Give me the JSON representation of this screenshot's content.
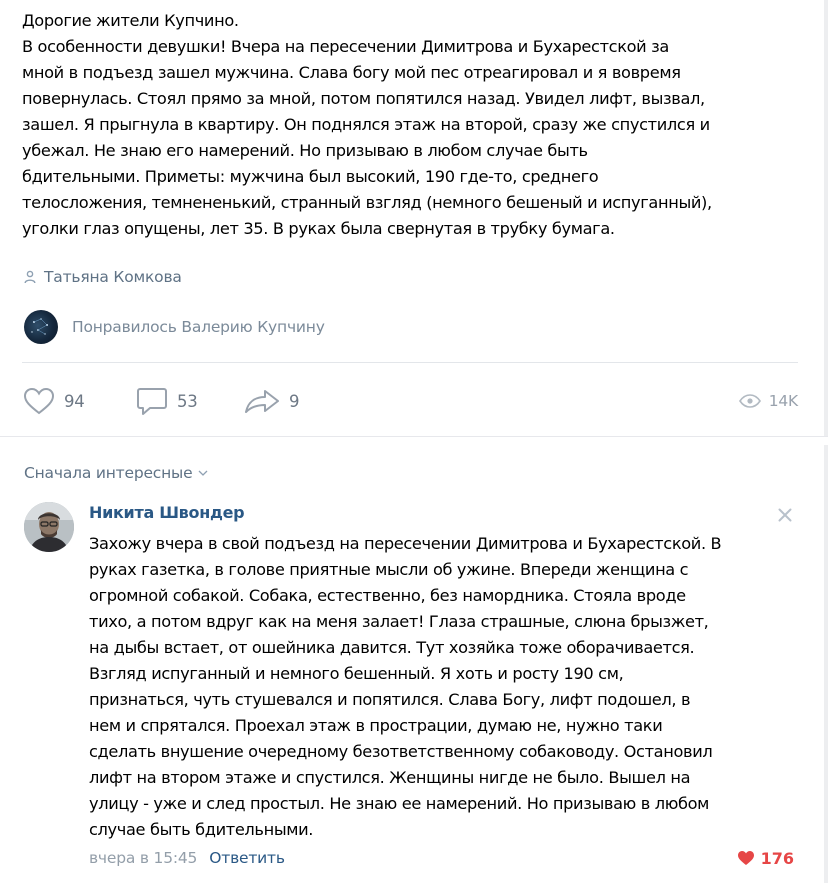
{
  "post": {
    "lines": [
      "Дорогие жители Купчино.",
      "В особенности девушки! Вчера на пересечении Димитрова и Бухарестской за",
      "мной в подъезд зашел мужчина. Слава богу мой пес отреагировал и я вовремя",
      "повернулась. Стоял прямо за мной, потом попятился назад. Увидел лифт, вызвал,",
      "зашел. Я прыгнула в квартиру. Он поднялся этаж на второй, сразу же спустился и",
      "убежал. Не знаю его намерений. Но призываю в любом случае быть",
      "бдительными. Приметы: мужчина был высокий, 190 где-то, среднего",
      "телосложения, темнененький, странный взгляд (немного бешеный и испуганный),",
      "уголки глаз опущены, лет 35. В руках была свернутая в трубку бумага."
    ],
    "author": "Татьяна Комкова",
    "liked_by": "Понравилось Валерию Купчину",
    "likes": "94",
    "comments": "53",
    "shares": "9",
    "views": "14K"
  },
  "sort_label": "Сначала интересные",
  "comment": {
    "name": "Никита Швондер",
    "lines": [
      "Захожу вчера в свой подъезд на пересечении Димитрова и Бухарестской. В",
      "руках газетка, в голове приятные мысли об ужине. Впереди женщина с",
      "огромной собакой. Собака, естественно, без намордника. Стояла вроде",
      "тихо, а потом вдруг как на меня залает! Глаза страшные, слюна брызжет,",
      "на дыбы встает, от ошейника давится. Тут хозяйка тоже оборачивается.",
      "Взгляд испуганный и немного бешенный. Я хоть и росту 190 см,",
      "признаться, чуть стушевался и попятился. Слава Богу, лифт подошел, в",
      "нем и спрятался. Проехал этаж в прострации, думаю не, нужно таки",
      "сделать внушение очередному безответственному собаководу. Остановил",
      "лифт на втором этаже и спустился. Женщины нигде не было. Вышел на",
      "улицу - уже и след простыл. Не знаю ее намерений. Но призываю в любом",
      "случае быть бдительными."
    ],
    "date": "вчера в 15:45",
    "reply_label": "Ответить",
    "likes": "176"
  },
  "colors": {
    "link": "#2a5885",
    "muted": "#6d7885",
    "like_active": "#e64646"
  },
  "icons": {
    "author": "person-icon",
    "like": "heart-icon",
    "comment": "comment-icon",
    "share": "share-arrow-icon",
    "views": "eye-icon",
    "close": "close-icon",
    "sort": "chevron-down-icon"
  }
}
